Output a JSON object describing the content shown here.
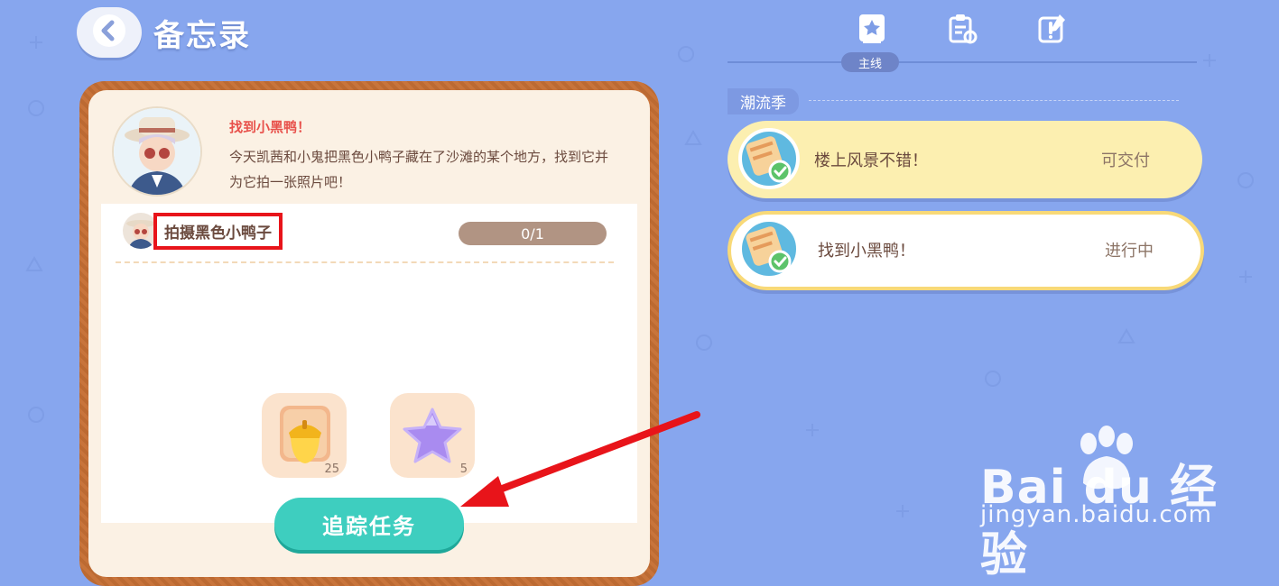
{
  "header": {
    "back_icon": "chevron-left-icon",
    "title": "备忘录"
  },
  "quest_card": {
    "title": "找到小黑鸭！",
    "description": "今天凯茜和小鬼把黑色小鸭子藏在了沙滩的某个地方，找到它并为它拍一张照片吧！",
    "task": {
      "label": "拍摄黑色小鸭子",
      "progress": "0/1"
    },
    "rewards": [
      {
        "icon": "acorn-icon",
        "count": "25"
      },
      {
        "icon": "star-icon",
        "count": "5"
      }
    ],
    "track_button": "追踪任务"
  },
  "tabs": {
    "items": [
      {
        "icon": "main-quest-book-icon"
      },
      {
        "icon": "clipboard-icon"
      },
      {
        "icon": "notebook-exclamation-icon"
      }
    ],
    "active_label": "主线"
  },
  "season": {
    "label": "潮流季"
  },
  "quest_list": [
    {
      "name": "楼上风景不错！",
      "status": "可交付",
      "icon": "quest-check-icon",
      "highlight": "yellow"
    },
    {
      "name": "找到小黑鸭！",
      "status": "进行中",
      "icon": "quest-check-icon",
      "highlight": "selected"
    }
  ],
  "watermark": {
    "logo_text": "Bai du 经验",
    "url": "jingyan.baidu.com"
  },
  "colors": {
    "background": "#87A6EE",
    "accent_red": "#E8514B",
    "track_button": "#3ECEBF",
    "annotation_red": "#E8141A"
  }
}
